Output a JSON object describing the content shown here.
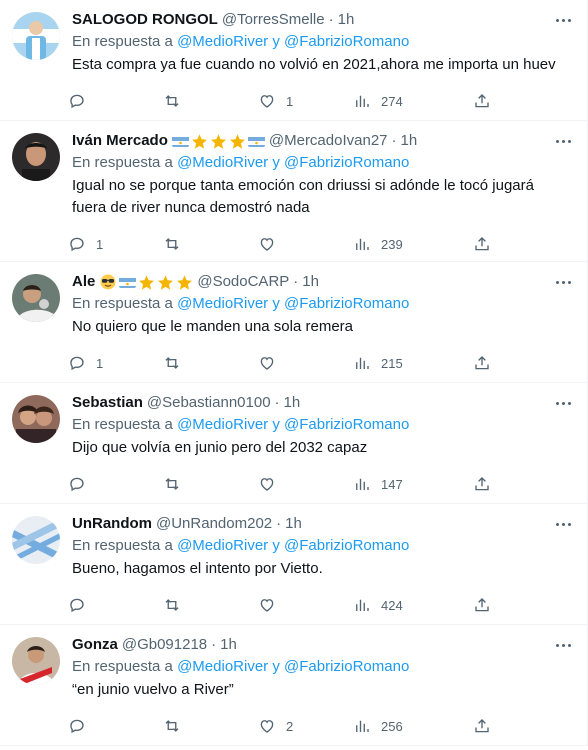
{
  "colors": {
    "link": "#1d9bf0",
    "muted": "#536471",
    "text": "#0f1419"
  },
  "tweets": [
    {
      "name": "SALOGOD RONGOL",
      "handle": "@TorresSmelle",
      "time": "1h",
      "reply_prefix": "En respuesta a",
      "reply_user1": "@MedioRiver",
      "reply_join": "y",
      "reply_user2": "@FabrizioRomano",
      "text": "Esta compra ya fue cuando no volvió en 2021,ahora me importa un huev",
      "replies": "",
      "retweets": "",
      "likes": "1",
      "views": "274",
      "emoji": []
    },
    {
      "name": "Iván Mercado",
      "handle": "@MercadoIvan27",
      "time": "1h",
      "reply_prefix": "En respuesta a",
      "reply_user1": "@MedioRiver",
      "reply_join": "y",
      "reply_user2": "@FabrizioRomano",
      "text": "Igual no se porque tanta emoción con driussi si adónde le tocó jugará fuera de river nunca demostró nada",
      "replies": "1",
      "retweets": "",
      "likes": "",
      "views": "239",
      "emoji": [
        "argentina-flag",
        "star",
        "star",
        "star",
        "argentina-flag"
      ]
    },
    {
      "name": "Ale",
      "handle": "@SodoCARP",
      "time": "1h",
      "reply_prefix": "En respuesta a",
      "reply_user1": "@MedioRiver",
      "reply_join": "y",
      "reply_user2": "@FabrizioRomano",
      "text": "No quiero que le manden una sola remera",
      "replies": "1",
      "retweets": "",
      "likes": "",
      "views": "215",
      "emoji": [
        "sunglasses-face",
        "argentina-flag",
        "star",
        "star",
        "star"
      ]
    },
    {
      "name": "Sebastian",
      "handle": "@Sebastiann0100",
      "time": "1h",
      "reply_prefix": "En respuesta a",
      "reply_user1": "@MedioRiver",
      "reply_join": "y",
      "reply_user2": "@FabrizioRomano",
      "text": "Dijo que volvía en junio pero del 2032 capaz",
      "replies": "",
      "retweets": "",
      "likes": "",
      "views": "147",
      "emoji": []
    },
    {
      "name": "UnRandom",
      "handle": "@UnRandom202",
      "time": "1h",
      "reply_prefix": "En respuesta a",
      "reply_user1": "@MedioRiver",
      "reply_join": "y",
      "reply_user2": "@FabrizioRomano",
      "text": "Bueno, hagamos el intento por Vietto.",
      "replies": "",
      "retweets": "",
      "likes": "",
      "views": "424",
      "emoji": []
    },
    {
      "name": "Gonza",
      "handle": "@Gb091218",
      "time": "1h",
      "reply_prefix": "En respuesta a",
      "reply_user1": "@MedioRiver",
      "reply_join": "y",
      "reply_user2": "@FabrizioRomano",
      "text": "“en junio vuelvo a River”",
      "replies": "",
      "retweets": "",
      "likes": "2",
      "views": "256",
      "emoji": []
    }
  ]
}
